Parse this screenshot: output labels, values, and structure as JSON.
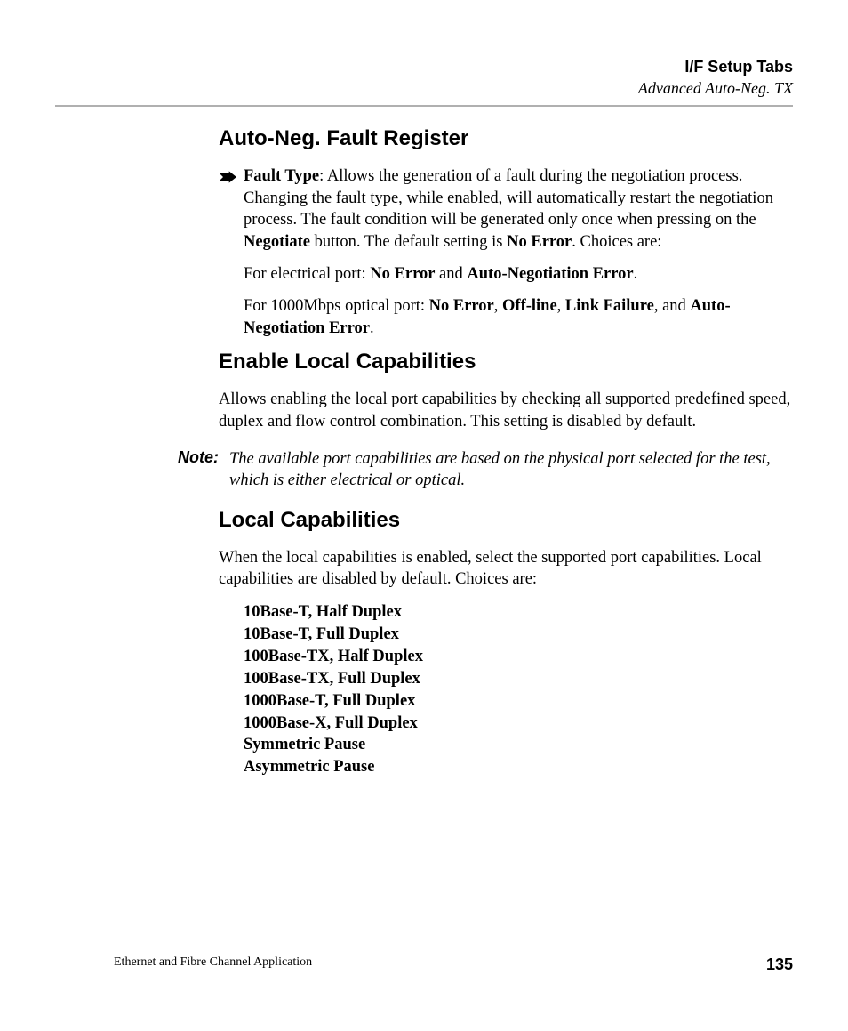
{
  "header": {
    "title": "I/F Setup Tabs",
    "subtitle": "Advanced Auto-Neg. TX"
  },
  "sections": {
    "fault_register": {
      "heading": "Auto-Neg. Fault Register",
      "fault_type_label": "Fault Type",
      "fault_type_text_1": ": Allows the generation of a fault during the negotiation process. Changing the fault type, while enabled, will automatically restart the negotiation process. The fault condition will be generated only once when pressing on the ",
      "negotiate_label": "Negotiate",
      "fault_type_text_2": " button. The default setting is ",
      "no_error_label": "No Error",
      "fault_type_text_3": ". Choices are:",
      "elec_prefix": "For electrical port: ",
      "elec_choice1": "No Error",
      "elec_and": " and ",
      "elec_choice2": "Auto-Negotiation Error",
      "elec_suffix": ".",
      "opt_prefix": "For 1000Mbps optical port: ",
      "opt_c1": "No Error",
      "sep1": ", ",
      "opt_c2": "Off-line",
      "sep2": ", ",
      "opt_c3": "Link Failure",
      "sep3": ", and ",
      "opt_c4": "Auto-Negotiation Error",
      "opt_suffix": "."
    },
    "enable_local": {
      "heading": "Enable Local Capabilities",
      "body": "Allows enabling the local port capabilities by checking all supported predefined speed, duplex and flow control combination. This setting is disabled by default."
    },
    "note": {
      "label": "Note:",
      "body": "The available port capabilities are based on the physical port selected for the test, which is either electrical or optical."
    },
    "local_caps": {
      "heading": "Local Capabilities",
      "intro": "When the local capabilities is enabled, select the supported port capabilities. Local capabilities are disabled by default. Choices are:",
      "items": [
        "10Base-T, Half Duplex",
        "10Base-T, Full Duplex",
        "100Base-TX, Half Duplex",
        "100Base-TX, Full Duplex",
        "1000Base-T, Full Duplex",
        "1000Base-X, Full Duplex",
        "Symmetric Pause",
        "Asymmetric Pause"
      ]
    }
  },
  "footer": {
    "left": "Ethernet and Fibre Channel Application",
    "page": "135"
  }
}
